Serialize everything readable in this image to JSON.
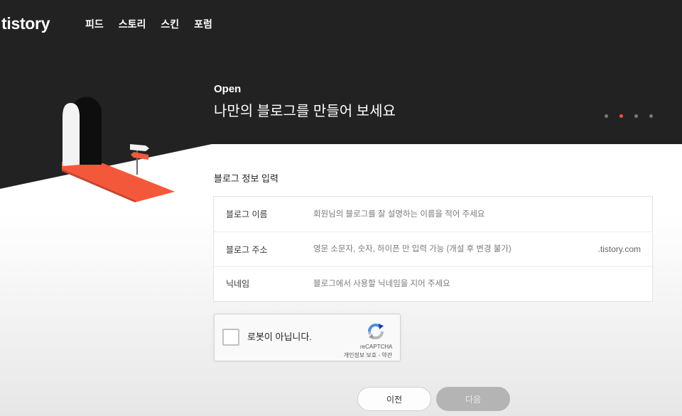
{
  "header": {
    "logo": "tistory",
    "nav": [
      {
        "label": "피드"
      },
      {
        "label": "스토리"
      },
      {
        "label": "스킨"
      },
      {
        "label": "포럼"
      }
    ]
  },
  "hero": {
    "eyebrow": "Open",
    "title": "나만의 블로그를 만들어 보세요",
    "steps": {
      "total": 4,
      "current": 2
    }
  },
  "form": {
    "section_title": "블로그 정보 입력",
    "fields": [
      {
        "label": "블로그 이름",
        "value": "",
        "placeholder": "회원님의 블로그를 잘 설명하는 이름을 적어 주세요"
      },
      {
        "label": "블로그 주소",
        "value": "",
        "placeholder": "영문 소문자, 숫자, 하이픈 만 입력 가능 (개설 후 변경 불가)",
        "suffix": ".tistory.com"
      },
      {
        "label": "닉네임",
        "value": "",
        "placeholder": "블로그에서 사용할 닉네임을 지어 주세요"
      }
    ]
  },
  "captcha": {
    "checked": false,
    "label": "로봇이 아닙니다.",
    "brand": "reCAPTCHA",
    "privacy": "개인정보 보호",
    "separator": " - ",
    "terms": "약관"
  },
  "buttons": {
    "prev": "이전",
    "next": "다음"
  },
  "icons": {
    "captcha": "recaptcha-logo-icon",
    "illustration": "open-door-illustration"
  },
  "colors": {
    "header_bg": "#222222",
    "accent": "#f4553d",
    "next_button_bg": "#b4b4b4"
  }
}
